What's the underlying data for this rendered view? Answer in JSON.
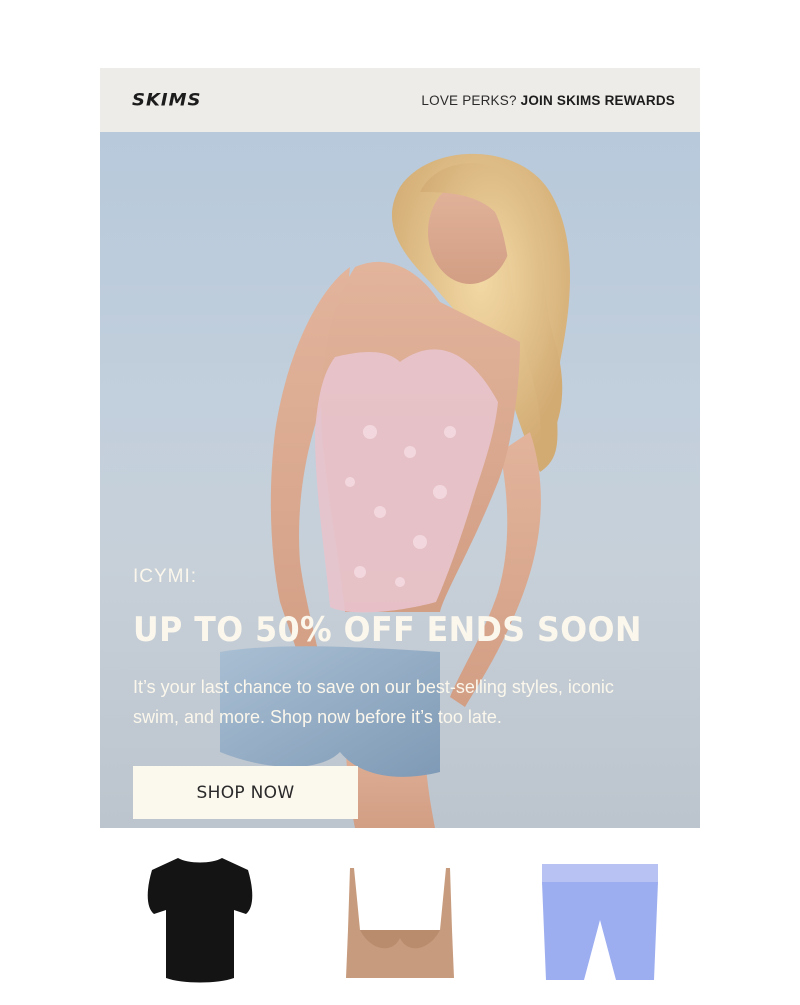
{
  "header": {
    "logo": "SKIMS",
    "perks_prefix": "LOVE PERKS? ",
    "perks_link": "JOIN SKIMS REWARDS"
  },
  "hero": {
    "eyebrow": "ICYMI:",
    "title": "UP TO 50% OFF ENDS SOON",
    "body": "It’s your last chance to save on our best-selling styles, iconic swim, and more. Shop now before it’s too late.",
    "cta_label": "SHOP NOW"
  },
  "products": [
    {
      "icon": "black-tee-icon",
      "color": "#141414"
    },
    {
      "icon": "nude-bralette-icon",
      "color": "#c79b7d"
    },
    {
      "icon": "blue-boxer-shorts-icon",
      "color": "#9cadf0"
    }
  ],
  "colors": {
    "header_bg": "#eeece8",
    "hero_text": "#fbf7ec",
    "button_bg": "#fbf8ee"
  }
}
